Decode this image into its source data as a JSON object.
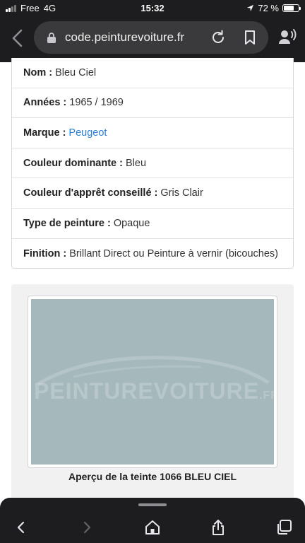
{
  "status": {
    "carrier": "Free",
    "network": "4G",
    "time": "15:32",
    "battery": "72 %",
    "battery_level": 0.72
  },
  "browser": {
    "url": "code.peinturevoiture.fr"
  },
  "info": {
    "rows": [
      {
        "label": "Nom :",
        "value": "Bleu Ciel"
      },
      {
        "label": "Années :",
        "value": "1965 / 1969"
      },
      {
        "label": "Marque :",
        "value": "Peugeot"
      },
      {
        "label": "Couleur dominante :",
        "value": "Bleu"
      },
      {
        "label": "Couleur d'apprêt conseillé :",
        "value": "Gris Clair"
      },
      {
        "label": "Type de peinture :",
        "value": "Opaque"
      },
      {
        "label": "Finition :",
        "value": "Brillant Direct ou Peinture à vernir (bicouches)"
      }
    ]
  },
  "preview": {
    "swatch_color": "#a5b8bc",
    "watermark_main": "PEINTUREVOITURE",
    "watermark_suffix": ".FR",
    "caption": "Aperçu de la teinte 1066 BLEU CIEL"
  },
  "colors": {
    "bar_bg": "#1d1d1f",
    "link": "#2a7fd4"
  },
  "icons": [
    "back-icon",
    "lock-icon",
    "reload-icon",
    "bookmark-icon",
    "reader-icon",
    "forward-icon",
    "home-icon",
    "share-icon",
    "tabs-icon"
  ]
}
